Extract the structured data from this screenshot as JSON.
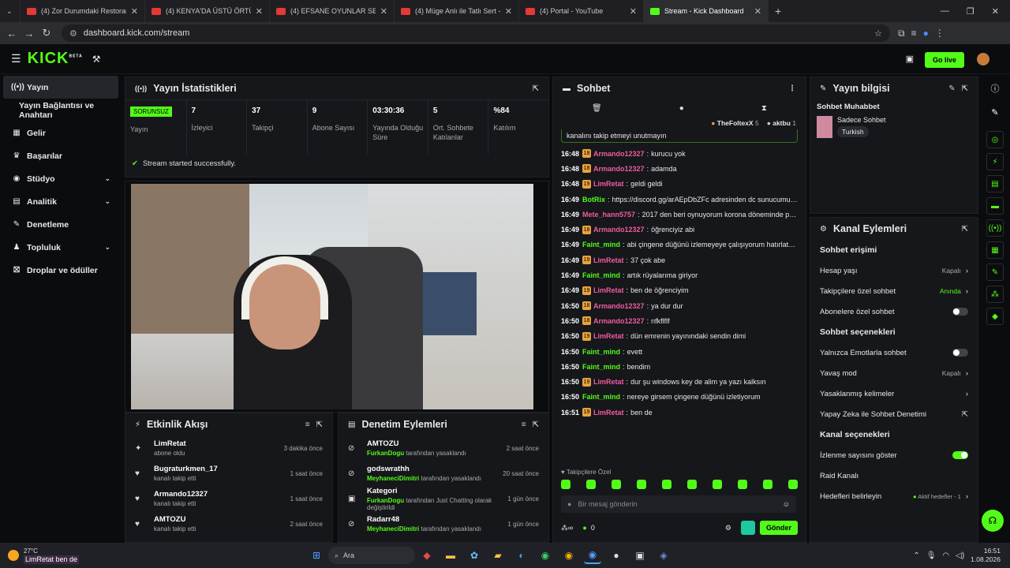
{
  "browser": {
    "tabs": [
      {
        "label": "(4) Zor Durumdaki Restoranlar",
        "active": false
      },
      {
        "label": "(4) KENYA'DA ÜSTÜ ÖRTÜLEN",
        "active": false
      },
      {
        "label": "(4) EFSANE OYUNLAR SERİSİ - Y",
        "active": false
      },
      {
        "label": "(4) Müge Anlı ile Tatlı Sert - You",
        "active": false
      },
      {
        "label": "(4) Portal - YouTube",
        "active": false
      },
      {
        "label": "Stream - Kick Dashboard",
        "active": true
      }
    ],
    "url": "dashboard.kick.com/stream"
  },
  "topnav": {
    "logo": "KICK",
    "logo_sup": "BETA",
    "go_live": "Go live"
  },
  "sidebar": {
    "items": [
      {
        "label": "Yayın",
        "icon": "broadcast-icon",
        "active": true
      },
      {
        "label": "Yayın Bağlantısı ve Anahtarı",
        "icon": "",
        "active": false
      },
      {
        "label": "Gelir",
        "icon": "money-icon",
        "active": false
      },
      {
        "label": "Başarılar",
        "icon": "trophy-icon",
        "active": false
      },
      {
        "label": "Stüdyo",
        "icon": "studio-icon",
        "active": false,
        "chevron": true
      },
      {
        "label": "Analitik",
        "icon": "chart-icon",
        "active": false,
        "chevron": true
      },
      {
        "label": "Denetleme",
        "icon": "wrench-icon",
        "active": false
      },
      {
        "label": "Topluluk",
        "icon": "community-icon",
        "active": false,
        "chevron": true
      },
      {
        "label": "Droplar ve ödüller",
        "icon": "gift-icon",
        "active": false
      }
    ]
  },
  "stats_panel": {
    "title": "Yayın İstatistikleri",
    "stream_badge": "SORUNSUZ",
    "stream_label": "Yayın",
    "stats": [
      {
        "value": "7",
        "label": "İzleyici"
      },
      {
        "value": "37",
        "label": "Takipçi"
      },
      {
        "value": "9",
        "label": "Abone Sayısı"
      },
      {
        "value": "03:30:36",
        "label": "Yayında Olduğu Süre"
      },
      {
        "value": "5",
        "label": "Ort. Sohbete Katılanlar"
      },
      {
        "value": "%84",
        "label": "Katılım"
      }
    ],
    "success_msg": "Stream started successfully."
  },
  "activity": {
    "title": "Etkinlik Akışı",
    "items": [
      {
        "icon": "sparkle-icon",
        "name": "LimRetat",
        "sub": "abone oldu",
        "time": "3 dakika önce"
      },
      {
        "icon": "heart-icon",
        "name": "Bugraturkmen_17",
        "sub": "kanalı takip etti",
        "time": "1 saat önce"
      },
      {
        "icon": "heart-icon",
        "name": "Armando12327",
        "sub": "kanalı takip etti",
        "time": "1 saat önce"
      },
      {
        "icon": "heart-icon",
        "name": "AMTOZU",
        "sub": "kanalı takip etti",
        "time": "2 saat önce"
      }
    ]
  },
  "moderation": {
    "title": "Denetim Eylemleri",
    "items": [
      {
        "icon": "ban-icon",
        "name": "AMTOZU",
        "mod": "FurkanDogu",
        "sub": "tarafından yasaklandı",
        "time": "2 saat önce"
      },
      {
        "icon": "ban-icon",
        "name": "godswrathh",
        "mod": "MeyhaneciDimitri",
        "sub": "tarafından yasaklandı",
        "time": "20 saat önce"
      },
      {
        "icon": "category-icon",
        "name": "Kategori",
        "mod": "FurkanDogu",
        "sub": "tarafından Just Chatting olarak değiştirildi",
        "time": "1 gün önce"
      },
      {
        "icon": "ban-icon",
        "name": "Radarr48",
        "mod": "MeyhaneciDimitri",
        "sub": "tarafından yasaklandı",
        "time": "1 gün önce"
      }
    ]
  },
  "chat": {
    "title": "Sohbet",
    "top_users": [
      {
        "name": "TheFoltexX",
        "count": "5"
      },
      {
        "name": "aktbu",
        "count": "1"
      }
    ],
    "pinned_text": "kanalını takip etmeyi unutmayın",
    "messages": [
      {
        "time": "16:48",
        "badge": "18",
        "user": "Armando12327",
        "color": "pink",
        "text": "kurucu yok"
      },
      {
        "time": "16:48",
        "badge": "18",
        "user": "Armando12327",
        "color": "pink",
        "text": "adamda"
      },
      {
        "time": "16:48",
        "badge": "19",
        "user": "LimRetat",
        "color": "pink",
        "text": "geldi geldi"
      },
      {
        "time": "16:49",
        "badge": "",
        "user": "BotRix",
        "color": "green",
        "text": "https://discord.gg/arAEpDbZFc adresinden dc sunucumuza gelebilirsiniz"
      },
      {
        "time": "16:49",
        "badge": "",
        "user": "Mete_hann5757",
        "color": "pink",
        "text": "2017 den beri oynuyorum korona döneminde peak yapti arka da canli ders acik rainbow six siege oynuyordum"
      },
      {
        "time": "16:49",
        "badge": "18",
        "user": "Armando12327",
        "color": "pink",
        "text": "öğrenciyiz abi"
      },
      {
        "time": "16:49",
        "badge": "",
        "user": "Faint_mind",
        "color": "green",
        "text": "abi çingene düğünü izlemeyeye çalışıyorum hatırlatma"
      },
      {
        "time": "16:49",
        "badge": "19",
        "user": "LimRetat",
        "color": "pink",
        "text": "37 çok abe"
      },
      {
        "time": "16:49",
        "badge": "",
        "user": "Faint_mind",
        "color": "green",
        "text": "artık rüyalarıma giriyor"
      },
      {
        "time": "16:49",
        "badge": "19",
        "user": "LimRetat",
        "color": "pink",
        "text": "ben de öğrenciyim"
      },
      {
        "time": "16:50",
        "badge": "18",
        "user": "Armando12327",
        "color": "pink",
        "text": "ya dur dur"
      },
      {
        "time": "16:50",
        "badge": "18",
        "user": "Armando12327",
        "color": "pink",
        "text": "nfkflflf"
      },
      {
        "time": "16:50",
        "badge": "19",
        "user": "LimRetat",
        "color": "pink",
        "text": "dün emrenin yayınındaki sendin dimi"
      },
      {
        "time": "16:50",
        "badge": "",
        "user": "Faint_mind",
        "color": "green",
        "text": "evett"
      },
      {
        "time": "16:50",
        "badge": "",
        "user": "Faint_mind",
        "color": "green",
        "text": "bendim"
      },
      {
        "time": "16:50",
        "badge": "19",
        "user": "LimRetat",
        "color": "pink",
        "text": "dur şu windows key de alim ya yazı kalksın"
      },
      {
        "time": "16:50",
        "badge": "",
        "user": "Faint_mind",
        "color": "green",
        "text": "nereye girsem çingene düğünü izletiyorum"
      },
      {
        "time": "16:51",
        "badge": "19",
        "user": "LimRetat",
        "color": "pink",
        "text": "ben de"
      }
    ],
    "followers_only": "Takipçilere Özel",
    "input_placeholder": "Bir mesaj gönderin",
    "points": "0",
    "send": "Gönder"
  },
  "stream_info": {
    "title": "Yayın bilgisi",
    "stream_title": "Sohbet Muhabbet",
    "category": "Sadece Sohbet",
    "tag": "Turkish"
  },
  "channel_actions": {
    "title": "Kanal Eylemleri",
    "sections": [
      {
        "name": "Sohbet erişimi",
        "options": [
          {
            "label": "Hesap yaşı",
            "value": "Kapalı",
            "kind": "nav"
          },
          {
            "label": "Takipçilere özel sohbet",
            "value": "Anında",
            "kind": "nav",
            "green": true
          },
          {
            "label": "Abonelere özel sohbet",
            "value": "",
            "kind": "toggle",
            "on": false
          }
        ]
      },
      {
        "name": "Sohbet seçenekleri",
        "options": [
          {
            "label": "Yalnızca Emotlarla sohbet",
            "value": "",
            "kind": "toggle",
            "on": false
          },
          {
            "label": "Yavaş mod",
            "value": "Kapalı",
            "kind": "nav"
          },
          {
            "label": "Yasaklanmış kelimeler",
            "value": "",
            "kind": "nav"
          },
          {
            "label": "Yapay Zeka ile Sohbet Denetimi",
            "value": "",
            "kind": "ext"
          }
        ]
      },
      {
        "name": "Kanal seçenekleri",
        "options": [
          {
            "label": "İzlenme sayısını göster",
            "value": "",
            "kind": "toggle",
            "on": true
          },
          {
            "label": "Raid Kanalı",
            "value": "",
            "kind": "none"
          },
          {
            "label": "Hedefleri belirleyin",
            "value": "Aktif hedefler - 1",
            "kind": "nav",
            "green": false
          }
        ]
      }
    ]
  },
  "taskbar": {
    "weather": "27°C",
    "notification": "LimRetat  ben de",
    "search": "Ara",
    "time": "16:51",
    "date": "1.08.2026"
  },
  "colors": {
    "accent": "#53fc18",
    "bg": "#0b0c0e",
    "panel": "#16171b"
  }
}
